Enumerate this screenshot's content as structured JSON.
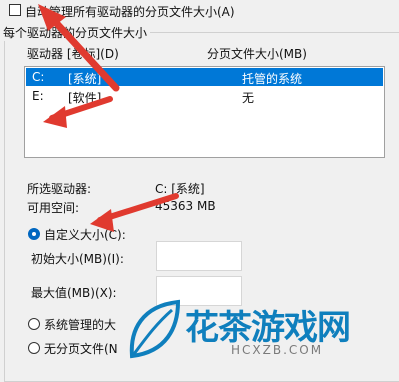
{
  "auto_manage_label": "自动管理所有驱动器的分页文件大小(A)",
  "auto_manage_checked": false,
  "group_title": "每个驱动器的分页文件大小",
  "list": {
    "header_drive": "驱动器 [卷标](D)",
    "header_size": "分页文件大小(MB)",
    "rows": [
      {
        "drive": "C:",
        "label": "[系统]",
        "size": "托管的系统",
        "selected": true
      },
      {
        "drive": "E:",
        "label": "[软件]",
        "size": "无",
        "selected": false
      }
    ]
  },
  "selected_drive_label": "所选驱动器:",
  "selected_drive_value": "C:  [系统]",
  "free_space_label": "可用空间:",
  "free_space_value": "45363 MB",
  "options": {
    "custom_label": "自定义大小(C):",
    "custom_checked": true,
    "initial_label": "初始大小(MB)(I):",
    "initial_value": "",
    "max_label": "最大值(MB)(X):",
    "max_value": "",
    "system_managed_label": "系统管理的大",
    "no_paging_label": "无分页文件(N"
  },
  "watermark": {
    "text": "花茶游戏网",
    "url": "HCXZB.COM"
  },
  "colors": {
    "selection": "#0078d7",
    "arrow": "#e03a2f",
    "watermark": "#0f7fbd"
  }
}
